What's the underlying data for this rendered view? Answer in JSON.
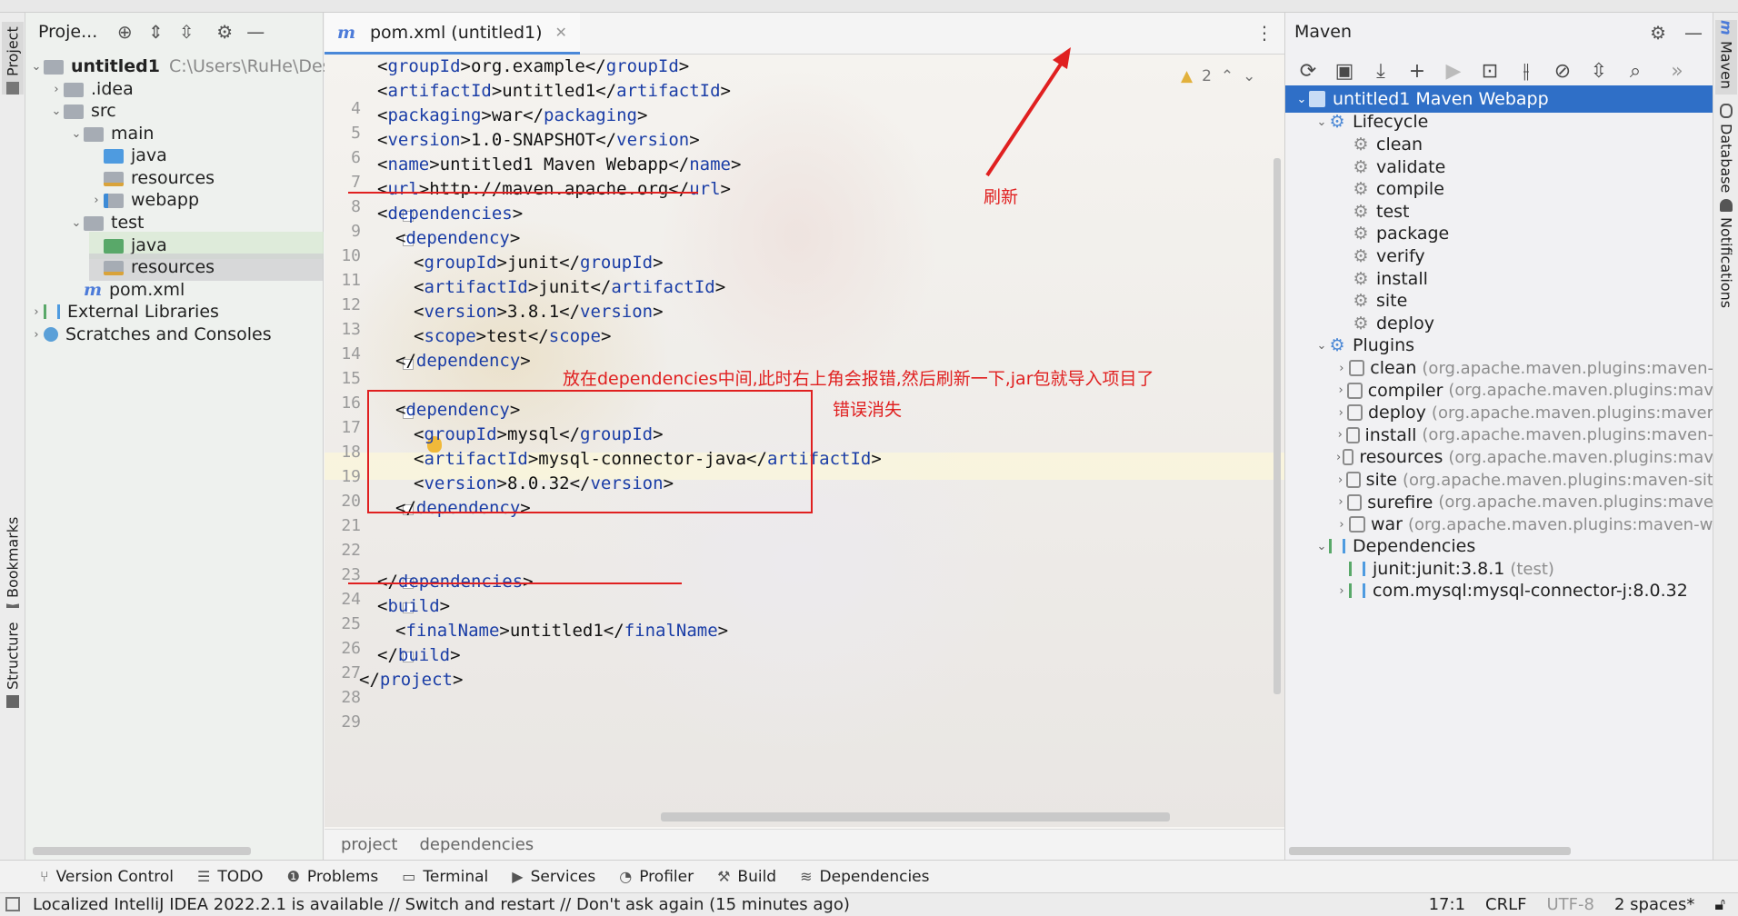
{
  "project_panel": {
    "title": "Proje...",
    "tree": [
      {
        "label": "untitled1",
        "extra": "C:\\Users\\RuHe\\Desk"
      },
      {
        "label": ".idea"
      },
      {
        "label": "src"
      },
      {
        "label": "main"
      },
      {
        "label": "java"
      },
      {
        "label": "resources"
      },
      {
        "label": "webapp"
      },
      {
        "label": "test"
      },
      {
        "label": "java"
      },
      {
        "label": "resources"
      },
      {
        "label": "pom.xml"
      },
      {
        "label": "External Libraries"
      },
      {
        "label": "Scratches and Consoles"
      }
    ]
  },
  "left_stripe": {
    "project": "Project",
    "bookmarks": "Bookmarks",
    "structure": "Structure"
  },
  "right_stripe": {
    "maven": "Maven",
    "database": "Database",
    "notifications": "Notifications"
  },
  "editor": {
    "tab_label": "pom.xml (untitled1)",
    "inspection_count": "2",
    "lines": [
      {
        "n": "4",
        "t": "<groupId>org.example</groupId>"
      },
      {
        "n": "5",
        "t": "<artifactId>untitled1</artifactId>"
      },
      {
        "n": "6",
        "t": "<packaging>war</packaging>"
      },
      {
        "n": "7",
        "t": "<version>1.0-SNAPSHOT</version>"
      },
      {
        "n": "8",
        "t": "<name>untitled1 Maven Webapp</name>"
      },
      {
        "n": "9",
        "t": "<url>http://maven.apache.org</url>"
      },
      {
        "n": "10",
        "t": "<dependencies>"
      },
      {
        "n": "11",
        "t": "<dependency>"
      },
      {
        "n": "12",
        "t": "<groupId>junit</groupId>"
      },
      {
        "n": "13",
        "t": "<artifactId>junit</artifactId>"
      },
      {
        "n": "14",
        "t": "<version>3.8.1</version>"
      },
      {
        "n": "15",
        "t": "<scope>test</scope>"
      },
      {
        "n": "16",
        "t": "</dependency>"
      },
      {
        "n": "17",
        "t": ""
      },
      {
        "n": "18",
        "t": "<dependency>"
      },
      {
        "n": "19",
        "t": "<groupId>mysql</groupId>"
      },
      {
        "n": "20",
        "t": "<artifactId>mysql-connector-java</artifactId>"
      },
      {
        "n": "21",
        "t": "<version>8.0.32</version>"
      },
      {
        "n": "22",
        "t": "</dependency>"
      },
      {
        "n": "23",
        "t": ""
      },
      {
        "n": "24",
        "t": ""
      },
      {
        "n": "25",
        "t": "</dependencies>"
      },
      {
        "n": "26",
        "t": "<build>"
      },
      {
        "n": "27",
        "t": "<finalName>untitled1</finalName>"
      },
      {
        "n": "28",
        "t": "</build>"
      },
      {
        "n": "29",
        "t": "</project>"
      }
    ],
    "breadcrumbs": [
      "project",
      "dependencies"
    ]
  },
  "annotations": {
    "refresh": "刷新",
    "note": "放在dependencies中间,此时右上角会报错,然后刷新一下,jar包就导入项目了",
    "error_gone": "错误消失"
  },
  "maven": {
    "title": "Maven",
    "root": "untitled1 Maven Webapp",
    "lifecycle_label": "Lifecycle",
    "lifecycle": [
      "clean",
      "validate",
      "compile",
      "test",
      "package",
      "verify",
      "install",
      "site",
      "deploy"
    ],
    "plugins_label": "Plugins",
    "plugins": [
      {
        "name": "clean",
        "detail": "(org.apache.maven.plugins:maven-"
      },
      {
        "name": "compiler",
        "detail": "(org.apache.maven.plugins:mav"
      },
      {
        "name": "deploy",
        "detail": "(org.apache.maven.plugins:maver"
      },
      {
        "name": "install",
        "detail": "(org.apache.maven.plugins:maven-"
      },
      {
        "name": "resources",
        "detail": "(org.apache.maven.plugins:mav"
      },
      {
        "name": "site",
        "detail": "(org.apache.maven.plugins:maven-sit"
      },
      {
        "name": "surefire",
        "detail": "(org.apache.maven.plugins:mave"
      },
      {
        "name": "war",
        "detail": "(org.apache.maven.plugins:maven-w"
      }
    ],
    "dependencies_label": "Dependencies",
    "dependencies": [
      {
        "name": "junit:junit:3.8.1",
        "detail": "(test)"
      },
      {
        "name": "com.mysql:mysql-connector-j:8.0.32",
        "detail": ""
      }
    ]
  },
  "bottom_tools": [
    "Version Control",
    "TODO",
    "Problems",
    "Terminal",
    "Services",
    "Profiler",
    "Build",
    "Dependencies"
  ],
  "status": {
    "message": "Localized IntelliJ IDEA 2022.2.1 is available // Switch and restart // Don't ask again (15 minutes ago)",
    "position": "17:1",
    "line_sep": "CRLF",
    "encoding": "UTF-8",
    "indent": "2 spaces*"
  },
  "colors": {
    "accent": "#2f6fc7",
    "annotation": "#e02020",
    "xml_tag": "#1a3da6"
  }
}
